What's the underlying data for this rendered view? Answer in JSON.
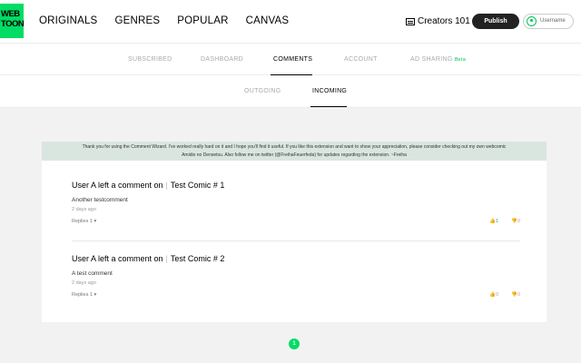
{
  "brand": {
    "logo_line1": "WEB",
    "logo_line2": "TOON",
    "accent": "#00dc64"
  },
  "nav": [
    "ORIGINALS",
    "GENRES",
    "POPULAR",
    "CANVAS"
  ],
  "header": {
    "creators": "Creators 101",
    "publish": "Publish",
    "username": "Username"
  },
  "subnav": {
    "subscribed": "SUBSCRIBED",
    "dashboard": "DASHBOARD",
    "comments": "COMMENTS",
    "account": "ACCOUNT",
    "ad_sharing": "AD SHARING",
    "beta": "Beta"
  },
  "thirdnav": {
    "outgoing": "OUTGOING",
    "incoming": "INCOMING"
  },
  "notice": {
    "line1": "Thank you for using the Comment Wizard. I've worked really hard on it and I hope you'll find it useful. If you like this extension and want to show your appreciation, please consider checking out my own webcomic",
    "line2": "Amidio no Densetsu. Also follow me on twitter (@FreihaFeuerfeda) for updates regarding the extension. ~Freiha"
  },
  "comments": [
    {
      "user": "User A left a comment on",
      "comic": "Test Comic",
      "episode": "# 1",
      "text": "Another testcomment",
      "time": "2 days ago",
      "replies": "Replies 1 ▾",
      "likes": "1",
      "dislikes": "0"
    },
    {
      "user": "User A left a comment on",
      "comic": "Test Comic",
      "episode": "# 2",
      "text": "A test comment",
      "time": "2 days ago",
      "replies": "Replies 1 ▾",
      "likes": "0",
      "dislikes": "0"
    }
  ],
  "pagination": {
    "current": "1"
  }
}
